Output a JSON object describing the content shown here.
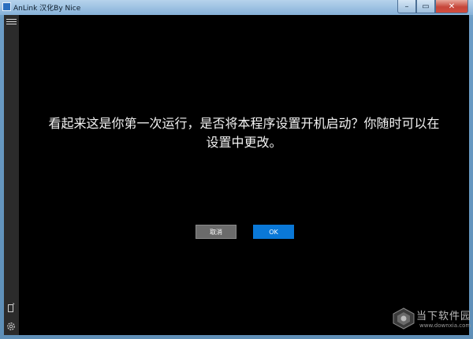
{
  "window": {
    "title": "AnLink 汉化By Nice",
    "minimize_glyph": "–",
    "maximize_glyph": "▭",
    "close_glyph": "✕"
  },
  "dialog": {
    "message_line1": "看起来这是你第一次运行，是否将本程序设置开机启动？你随时可以在",
    "message_line2": "设置中更改。",
    "cancel_label": "取消",
    "ok_label": "OK"
  },
  "sidebar": {
    "icons": [
      "hamburger-menu-icon",
      "phone-icon",
      "gear-icon"
    ]
  },
  "watermark": {
    "title": "当下软件园",
    "url": "www.downxia.com"
  },
  "colors": {
    "background": "#000000",
    "sidebar": "#2b2b2b",
    "ok_button": "#0a78d7",
    "cancel_button": "#6b6b6b"
  }
}
